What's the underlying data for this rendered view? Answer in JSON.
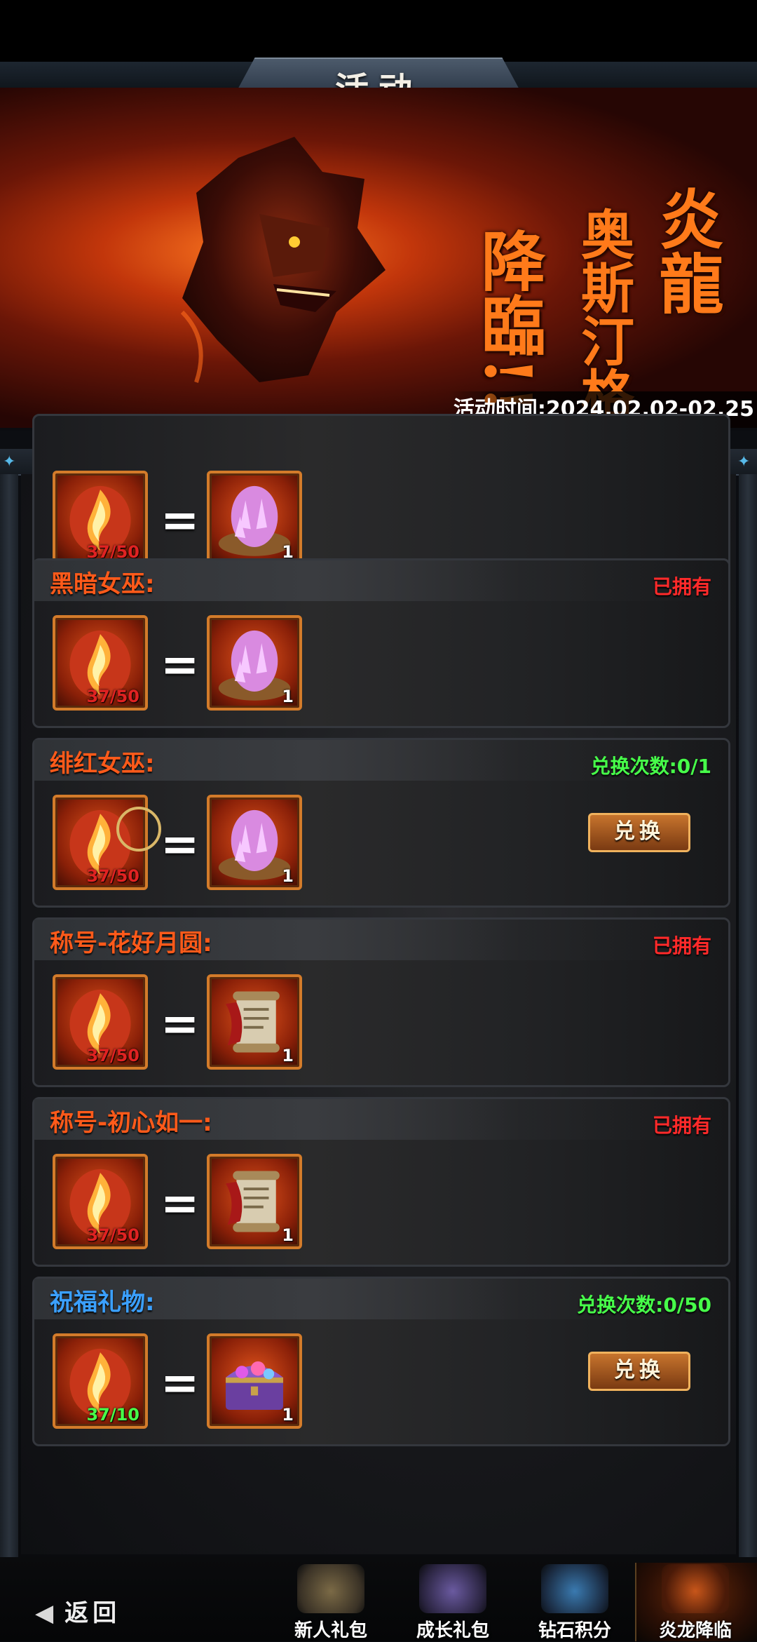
{
  "header": {
    "title": "活动"
  },
  "banner": {
    "title_col1": "炎龍",
    "title_col2": "奥斯汀格",
    "title_col3": "降臨!!",
    "date_text": "活动时间:2024.02.02-02.25"
  },
  "rewards": [
    {
      "title": "",
      "status": "",
      "cost_count": "37/50",
      "reward_count": "1",
      "reward_icon": "crystal-egg-icon"
    },
    {
      "title": "黑暗女巫",
      "status": "已拥有",
      "status_kind": "owned",
      "cost_count": "37/50",
      "reward_count": "1",
      "reward_icon": "crystal-egg-icon"
    },
    {
      "title": "绯红女巫",
      "status": "兑换次数:0/1",
      "status_kind": "count",
      "cost_count": "37/50",
      "reward_count": "1",
      "reward_icon": "crystal-egg-icon",
      "button": "兑换"
    },
    {
      "title": "称号-花好月圆",
      "status": "已拥有",
      "status_kind": "owned",
      "cost_count": "37/50",
      "reward_count": "1",
      "reward_icon": "scroll-icon"
    },
    {
      "title": "称号-初心如一",
      "status": "已拥有",
      "status_kind": "owned",
      "cost_count": "37/50",
      "reward_count": "1",
      "reward_icon": "scroll-icon"
    },
    {
      "title": "祝福礼物",
      "status": "兑换次数:0/50",
      "status_kind": "count",
      "cost_count": "37/10",
      "reward_count": "1",
      "reward_icon": "treasure-chest-icon",
      "button": "兑换"
    }
  ],
  "colon": ":",
  "nav": {
    "back_label": "返回",
    "items": [
      {
        "label": "新人礼包",
        "icon": "gift-chest-icon"
      },
      {
        "label": "成长礼包",
        "icon": "hooded-figure-icon"
      },
      {
        "label": "钻石积分",
        "icon": "diamond-hero-icon"
      },
      {
        "label": "炎龙降临",
        "icon": "fire-dragon-icon"
      }
    ]
  },
  "colors": {
    "title_orange": "#ff5a1a",
    "title_blue": "#3ba0ff",
    "status_red": "#ff2a2a",
    "status_green": "#47ff4a",
    "slot_border": "#d37b2a"
  }
}
